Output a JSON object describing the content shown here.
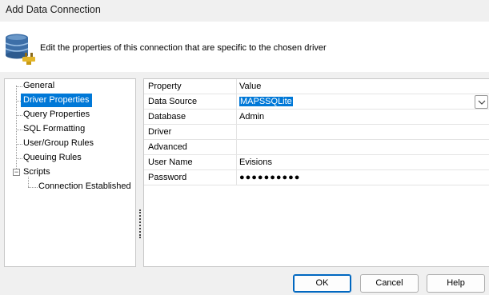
{
  "window": {
    "title": "Add Data Connection"
  },
  "header": {
    "description": "Edit the properties of this connection that are specific to the chosen driver",
    "icon": "database-plug-icon"
  },
  "tree": {
    "items": [
      {
        "label": "General"
      },
      {
        "label": "Driver Properties",
        "selected": true
      },
      {
        "label": "Query Properties"
      },
      {
        "label": "SQL Formatting"
      },
      {
        "label": "User/Group Rules"
      },
      {
        "label": "Queuing Rules"
      },
      {
        "label": "Scripts",
        "expander": "−"
      },
      {
        "label": "Connection Established"
      }
    ]
  },
  "grid": {
    "header": {
      "property": "Property",
      "value": "Value"
    },
    "rows": [
      {
        "name": "Data Source",
        "value": "MAPSSQLite"
      },
      {
        "name": "Database",
        "value": "Admin"
      },
      {
        "name": "Driver",
        "value": ""
      },
      {
        "name": "Advanced",
        "value": ""
      },
      {
        "name": "User Name",
        "value": "Evisions"
      },
      {
        "name": "Password",
        "value": "●●●●●●●●●●"
      }
    ]
  },
  "buttons": {
    "ok": "OK",
    "cancel": "Cancel",
    "help": "Help"
  },
  "colors": {
    "selection": "#0078d7",
    "primary_border": "#0067c0"
  }
}
